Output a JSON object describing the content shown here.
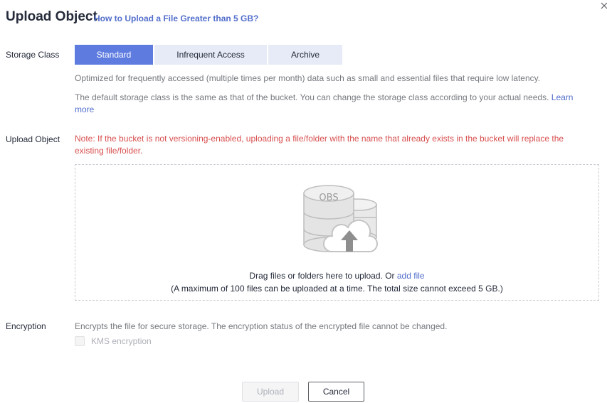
{
  "dialog": {
    "title": "Upload Object",
    "help_link": "How to Upload a File Greater than 5 GB?"
  },
  "storage_class": {
    "label": "Storage Class",
    "options": [
      "Standard",
      "Infrequent Access",
      "Archive"
    ],
    "selected": "Standard",
    "description": "Optimized for frequently accessed (multiple times per month) data such as small and essential files that require low latency.",
    "default_note_line1": "The default storage class is the same as that of the bucket. You can change the storage class according to your actual needs.",
    "learn_more_part1": "Learn",
    "learn_more_part2": "more"
  },
  "upload_object": {
    "label": "Upload Object",
    "note_line1": "Note: If the bucket is not versioning-enabled, uploading a file/folder with the name that already exists in the bucket will replace the",
    "note_line2": "existing file/folder.",
    "graphic_text": "OBS",
    "drop_text": "Drag files or folders here to upload. Or",
    "add_file_link": "add file",
    "limit_text": "(A maximum of 100 files can be uploaded at a time. The total size cannot exceed 5 GB.)"
  },
  "encryption": {
    "label": "Encryption",
    "description": "Encrypts the file for secure storage. The encryption status of the encrypted file cannot be changed.",
    "kms_label": "KMS encryption",
    "kms_checked": false,
    "kms_disabled": true
  },
  "footer": {
    "upload_label": "Upload",
    "upload_disabled": true,
    "cancel_label": "Cancel"
  },
  "colors": {
    "accent": "#5e7ce0",
    "link": "#526ecc",
    "warning_text": "#d84e4e",
    "segment_inactive": "#e6ebf7"
  },
  "icons": [
    "close-icon",
    "obs-storage-icon",
    "cloud-upload-icon"
  ]
}
